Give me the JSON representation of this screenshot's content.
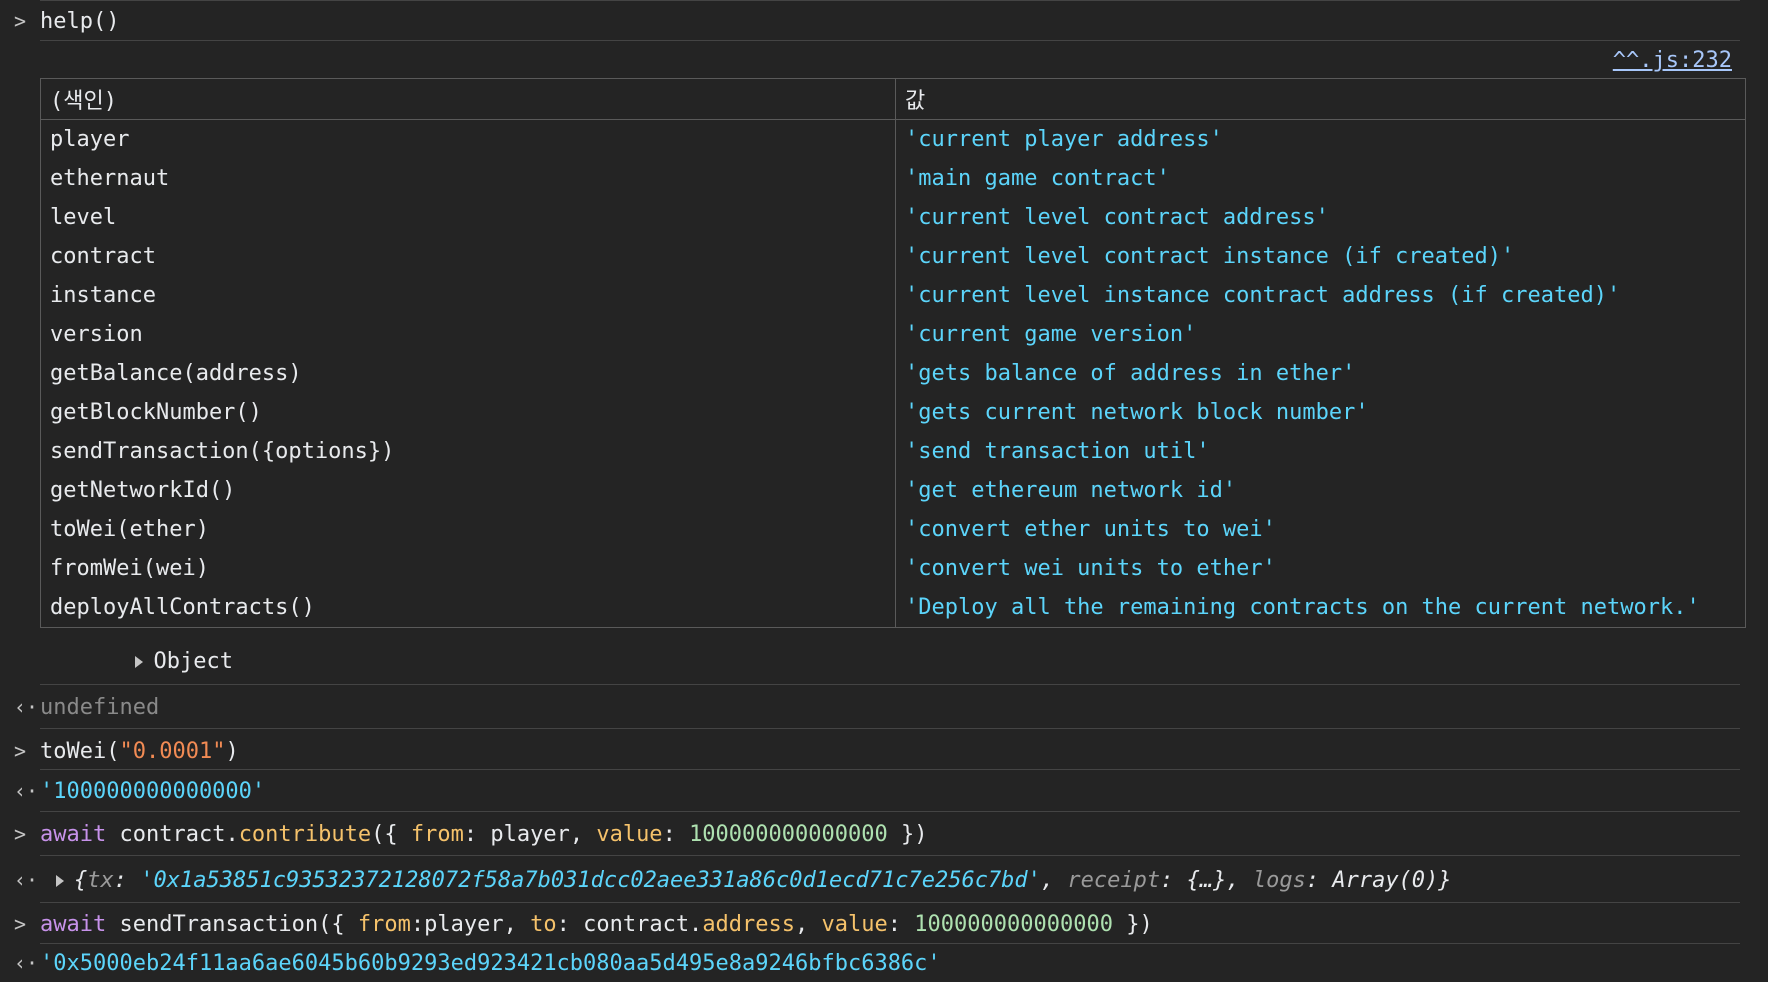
{
  "entries": {
    "help_call": "help()",
    "source_link": "^^.js:232",
    "table": {
      "headers": [
        "(색인)",
        "값"
      ],
      "rows": [
        {
          "key": "player",
          "value": "'current player address'"
        },
        {
          "key": "ethernaut",
          "value": "'main game contract'"
        },
        {
          "key": "level",
          "value": "'current level contract address'"
        },
        {
          "key": "contract",
          "value": "'current level contract instance (if created)'"
        },
        {
          "key": "instance",
          "value": "'current level instance contract address (if created)'"
        },
        {
          "key": "version",
          "value": "'current game version'"
        },
        {
          "key": "getBalance(address)",
          "value": "'gets balance of address in ether'"
        },
        {
          "key": "getBlockNumber()",
          "value": "'gets current network block number'"
        },
        {
          "key": "sendTransaction({options})",
          "value": "'send transaction util'"
        },
        {
          "key": "getNetworkId()",
          "value": "'get ethereum network id'"
        },
        {
          "key": "toWei(ether)",
          "value": "'convert ether units to wei'"
        },
        {
          "key": "fromWei(wei)",
          "value": "'convert wei units to ether'"
        },
        {
          "key": "deployAllContracts()",
          "value": "'Deploy all the remaining contracts on the current network.'"
        }
      ]
    },
    "object_label": "Object",
    "undefined_result": "undefined",
    "towei": {
      "fn": "toWei(",
      "arg": "\"0.0001\"",
      "close": ")"
    },
    "towei_result": "'100000000000000'",
    "contribute": {
      "kw": "await",
      "obj": " contract.",
      "method": "contribute",
      "open": "({ ",
      "from_key": "from",
      "from_val": ": player, ",
      "value_key": "value",
      "value_sep": ": ",
      "value_num": "100000000000000",
      "close": " })"
    },
    "contribute_result": {
      "open": "{",
      "tx_key": "tx",
      "tx_sep": ": ",
      "tx_val": "'0x1a53851c93532372128072f58a7b031dcc02aee331a86c0d1ecd71c7e256c7bd'",
      "receipt_pre": ", ",
      "receipt_key": "receipt",
      "receipt_val": ": {…}, ",
      "logs_key": "logs",
      "logs_val": ": Array(0)}"
    },
    "sendtx": {
      "kw": "await",
      "fn": " sendTransaction({ ",
      "from_key": "from",
      "from_val": ":player, ",
      "to_key": "to",
      "to_val": ": contract.",
      "addr_key": "address",
      "comma": ", ",
      "value_key": "value",
      "value_sep": ": ",
      "value_num": "100000000000000",
      "close": " })"
    },
    "sendtx_result": "'0x5000eb24f11aa6ae6045b60b9293ed923421cb080aa5d495e8a9246bfbc6386c'"
  },
  "icons": {
    "input_prompt": "chevron-right-icon",
    "output_prompt": "return-arrow-icon",
    "expand": "triangle-right-icon"
  },
  "colors": {
    "background": "#242424",
    "string": "#5cd5fb",
    "keyword": "#c792ea",
    "property": "#f5c26b",
    "number": "#aee1b0",
    "string_literal_input": "#f28b54",
    "link": "#a8c7fa"
  }
}
